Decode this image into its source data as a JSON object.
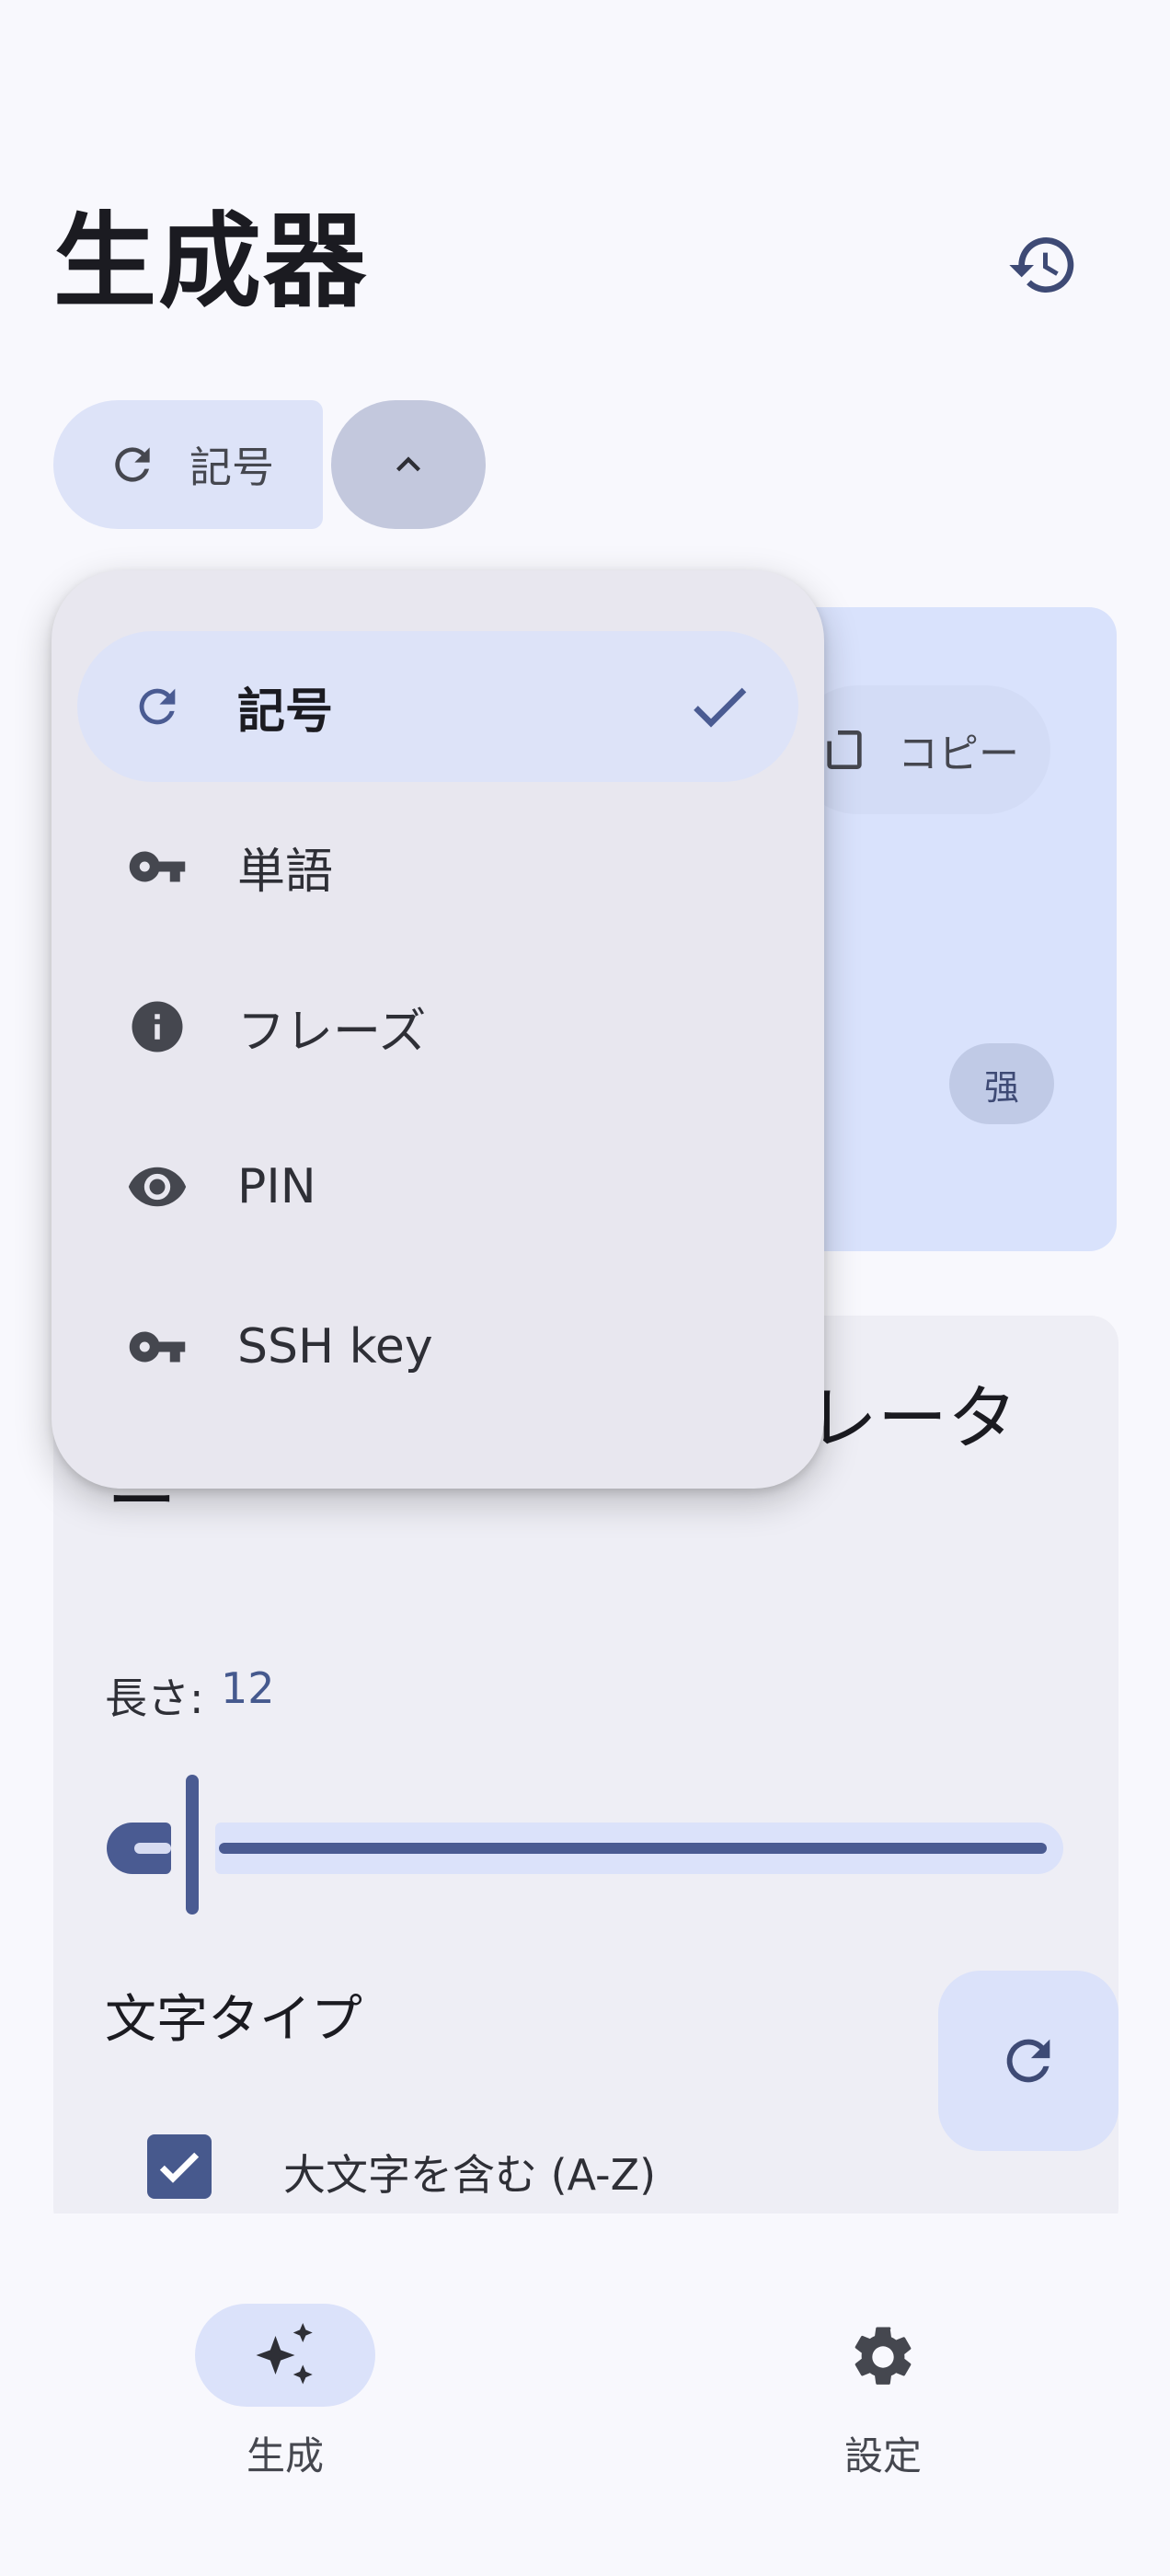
{
  "header": {
    "title": "生成器",
    "history_icon": "history-icon"
  },
  "type_selector": {
    "current_label": "記号",
    "current_icon": "refresh-icon",
    "toggle_icon": "chevron-up-icon"
  },
  "result_card": {
    "copy_label": "コピー",
    "strength_label": "强"
  },
  "settings_card": {
    "title_visible_part": "レータ",
    "title_wrap_part": "ー",
    "length_label": "長さ:",
    "length_value": "12",
    "length_fraction": 0.0,
    "char_types_label": "文字タイプ",
    "uppercase_label": "大文字を含む (A-Z)",
    "uppercase_checked": true
  },
  "menu": {
    "items": [
      {
        "label": "記号",
        "icon": "refresh-icon",
        "selected": true
      },
      {
        "label": "単語",
        "icon": "key-icon",
        "selected": false
      },
      {
        "label": "フレーズ",
        "icon": "info-icon",
        "selected": false
      },
      {
        "label": "PIN",
        "icon": "eye-icon",
        "selected": false
      },
      {
        "label": "SSH key",
        "icon": "key-icon",
        "selected": false
      }
    ]
  },
  "bottom_nav": {
    "items": [
      {
        "label": "生成",
        "icon": "sparkles-icon",
        "active": true
      },
      {
        "label": "設定",
        "icon": "gear-icon",
        "active": false
      }
    ]
  },
  "colors": {
    "primary": "#4a5b92",
    "primary_container": "#dde3f8",
    "surface": "#f8f8fd",
    "menu_surface": "#e8e7ef"
  }
}
